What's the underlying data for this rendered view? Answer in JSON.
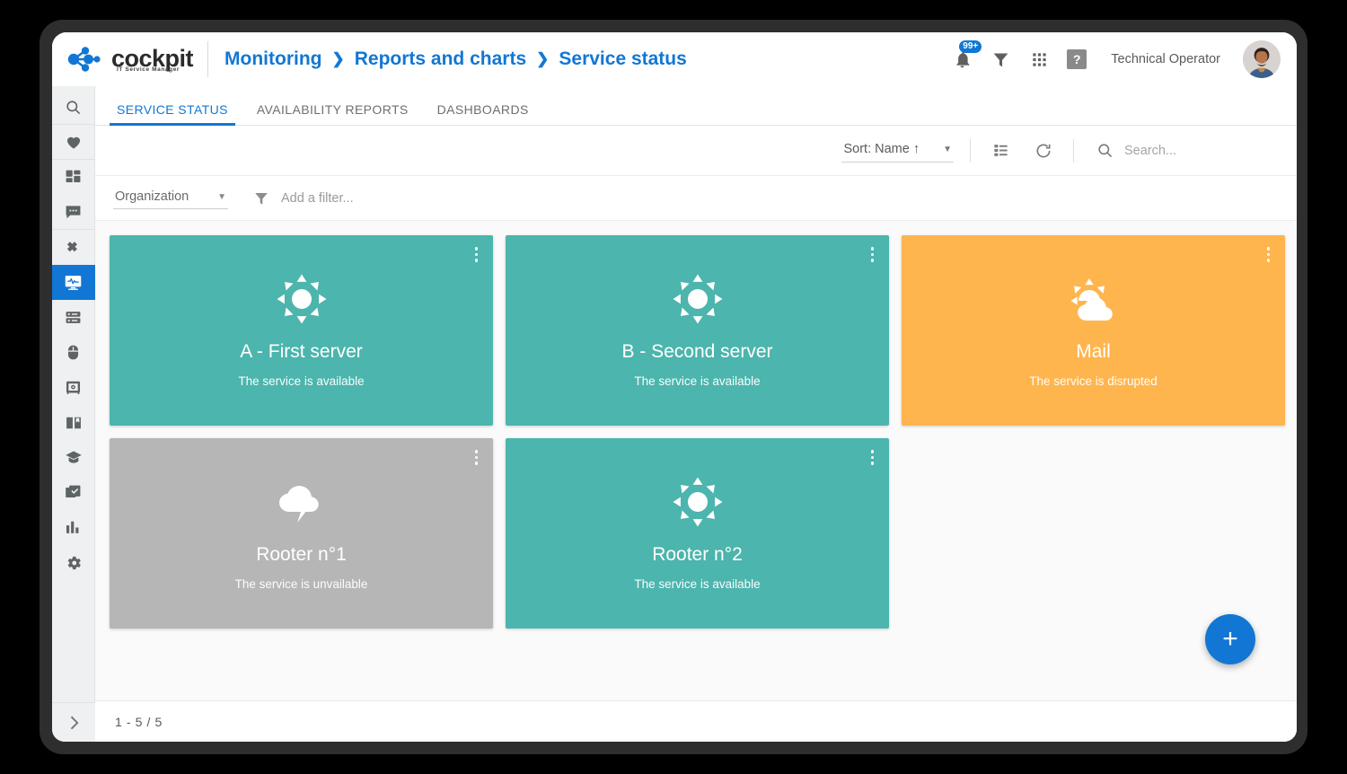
{
  "brand": {
    "name": "cockpit",
    "tagline": "IT Service Manager",
    "accent": "#1277d4"
  },
  "breadcrumb": {
    "items": [
      "Monitoring",
      "Reports and charts",
      "Service status"
    ],
    "separator": "❯"
  },
  "topbar": {
    "notifications_badge": "99+",
    "help_label": "?",
    "user_name": "Technical  Operator",
    "icons": [
      "bell-icon",
      "filter-icon",
      "apps-grid-icon",
      "help-icon"
    ]
  },
  "sidebar": {
    "items": [
      {
        "name": "search",
        "icon": "search-icon"
      },
      {
        "name": "favorites",
        "icon": "heart-icon"
      },
      {
        "name": "dashboard",
        "icon": "dashboard-grid-icon"
      },
      {
        "name": "messages",
        "icon": "chat-bubble-icon"
      },
      {
        "name": "tickets",
        "icon": "ticket-icon"
      },
      {
        "name": "monitoring",
        "icon": "monitor-pulse-icon",
        "active": true
      },
      {
        "name": "servers",
        "icon": "server-icon"
      },
      {
        "name": "devices",
        "icon": "mouse-icon"
      },
      {
        "name": "assets",
        "icon": "safe-icon"
      },
      {
        "name": "knowledge",
        "icon": "book-icon"
      },
      {
        "name": "training",
        "icon": "graduation-cap-icon"
      },
      {
        "name": "tasks",
        "icon": "checkbox-stack-icon"
      },
      {
        "name": "reports",
        "icon": "bar-chart-icon"
      },
      {
        "name": "settings",
        "icon": "gear-icon"
      }
    ],
    "expand_label": "›"
  },
  "tabs": [
    {
      "label": "SERVICE STATUS",
      "active": true
    },
    {
      "label": "AVAILABILITY REPORTS",
      "active": false
    },
    {
      "label": "DASHBOARDS",
      "active": false
    }
  ],
  "toolbar": {
    "sort_label": "Sort: Name ↑",
    "sort_caret": "▼",
    "list_view_icon": "list-view-icon",
    "refresh_icon": "refresh-icon",
    "search_icon": "search-icon",
    "search_placeholder": "Search..."
  },
  "filterbar": {
    "organization_label": "Organization",
    "organization_caret": "▼",
    "filter_icon": "funnel-icon",
    "add_filter_placeholder": "Add a filter..."
  },
  "cards": [
    {
      "title": "A - First server",
      "status": "The service is available",
      "icon": "sun-icon",
      "color": "#4cb5ad"
    },
    {
      "title": "B - Second server",
      "status": "The service is available",
      "icon": "sun-icon",
      "color": "#4cb5ad"
    },
    {
      "title": "Mail",
      "status": "The service is disrupted",
      "icon": "sun-behind-cloud-icon",
      "color": "#ffb54d"
    },
    {
      "title": "Rooter n°1",
      "status": "The service is unvailable",
      "icon": "storm-cloud-icon",
      "color": "#b6b6b6"
    },
    {
      "title": "Rooter n°2",
      "status": "The service is available",
      "icon": "sun-icon",
      "color": "#4cb5ad"
    }
  ],
  "fab": {
    "label": "+"
  },
  "footer": {
    "pagination": "1 - 5 / 5"
  }
}
